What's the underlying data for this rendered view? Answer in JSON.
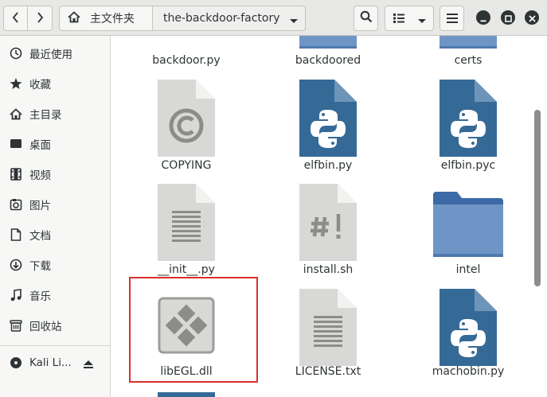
{
  "header": {
    "back_icon": "chevron-left-icon",
    "forward_icon": "chevron-right-icon",
    "path_home_icon": "home-icon",
    "path_home_label": "主文件夹",
    "path_current_label": "the-backdoor-factory",
    "search_icon": "search-icon",
    "view_icon": "list-view-icon",
    "menu_icon": "hamburger-menu-icon",
    "window_controls": [
      "minimize-icon",
      "maximize-icon",
      "close-icon"
    ]
  },
  "sidebar": {
    "items": [
      {
        "label": "最近使用",
        "icon": "clock-icon"
      },
      {
        "label": "收藏",
        "icon": "star-icon"
      },
      {
        "label": "主目录",
        "icon": "home-icon"
      },
      {
        "label": "桌面",
        "icon": "desktop-icon"
      },
      {
        "label": "视频",
        "icon": "video-icon"
      },
      {
        "label": "图片",
        "icon": "picture-icon"
      },
      {
        "label": "文档",
        "icon": "document-icon"
      },
      {
        "label": "下载",
        "icon": "download-icon"
      },
      {
        "label": "音乐",
        "icon": "music-icon"
      },
      {
        "label": "回收站",
        "icon": "trash-icon"
      }
    ],
    "devices": [
      {
        "label": "Kali Li...",
        "icon": "disk-icon",
        "action_icon": "eject-icon"
      }
    ]
  },
  "files": {
    "row0": [
      {
        "name": "backdoor.py"
      },
      {
        "name": "backdoored"
      },
      {
        "name": "certs"
      }
    ],
    "row1": [
      {
        "name": "COPYING",
        "icon": "copyright-file-icon"
      },
      {
        "name": "elfbin.py",
        "icon": "python-file-icon"
      },
      {
        "name": "elfbin.pyc",
        "icon": "python-file-icon"
      }
    ],
    "row2": [
      {
        "name": "__init__.py",
        "icon": "text-file-icon"
      },
      {
        "name": "install.sh",
        "icon": "script-file-icon"
      },
      {
        "name": "intel",
        "icon": "folder-icon"
      }
    ],
    "row3": [
      {
        "name": "libEGL.dll",
        "icon": "dll-file-icon"
      },
      {
        "name": "LICENSE.txt",
        "icon": "text-file-icon"
      },
      {
        "name": "machobin.py",
        "icon": "python-file-icon"
      }
    ]
  },
  "colors": {
    "header_bg": "#e8e8e7",
    "sidebar_bg": "#f7f7f6",
    "python_blue": "#366a96",
    "folder_blue": "#5583bd",
    "selection_red": "#d9302c"
  }
}
